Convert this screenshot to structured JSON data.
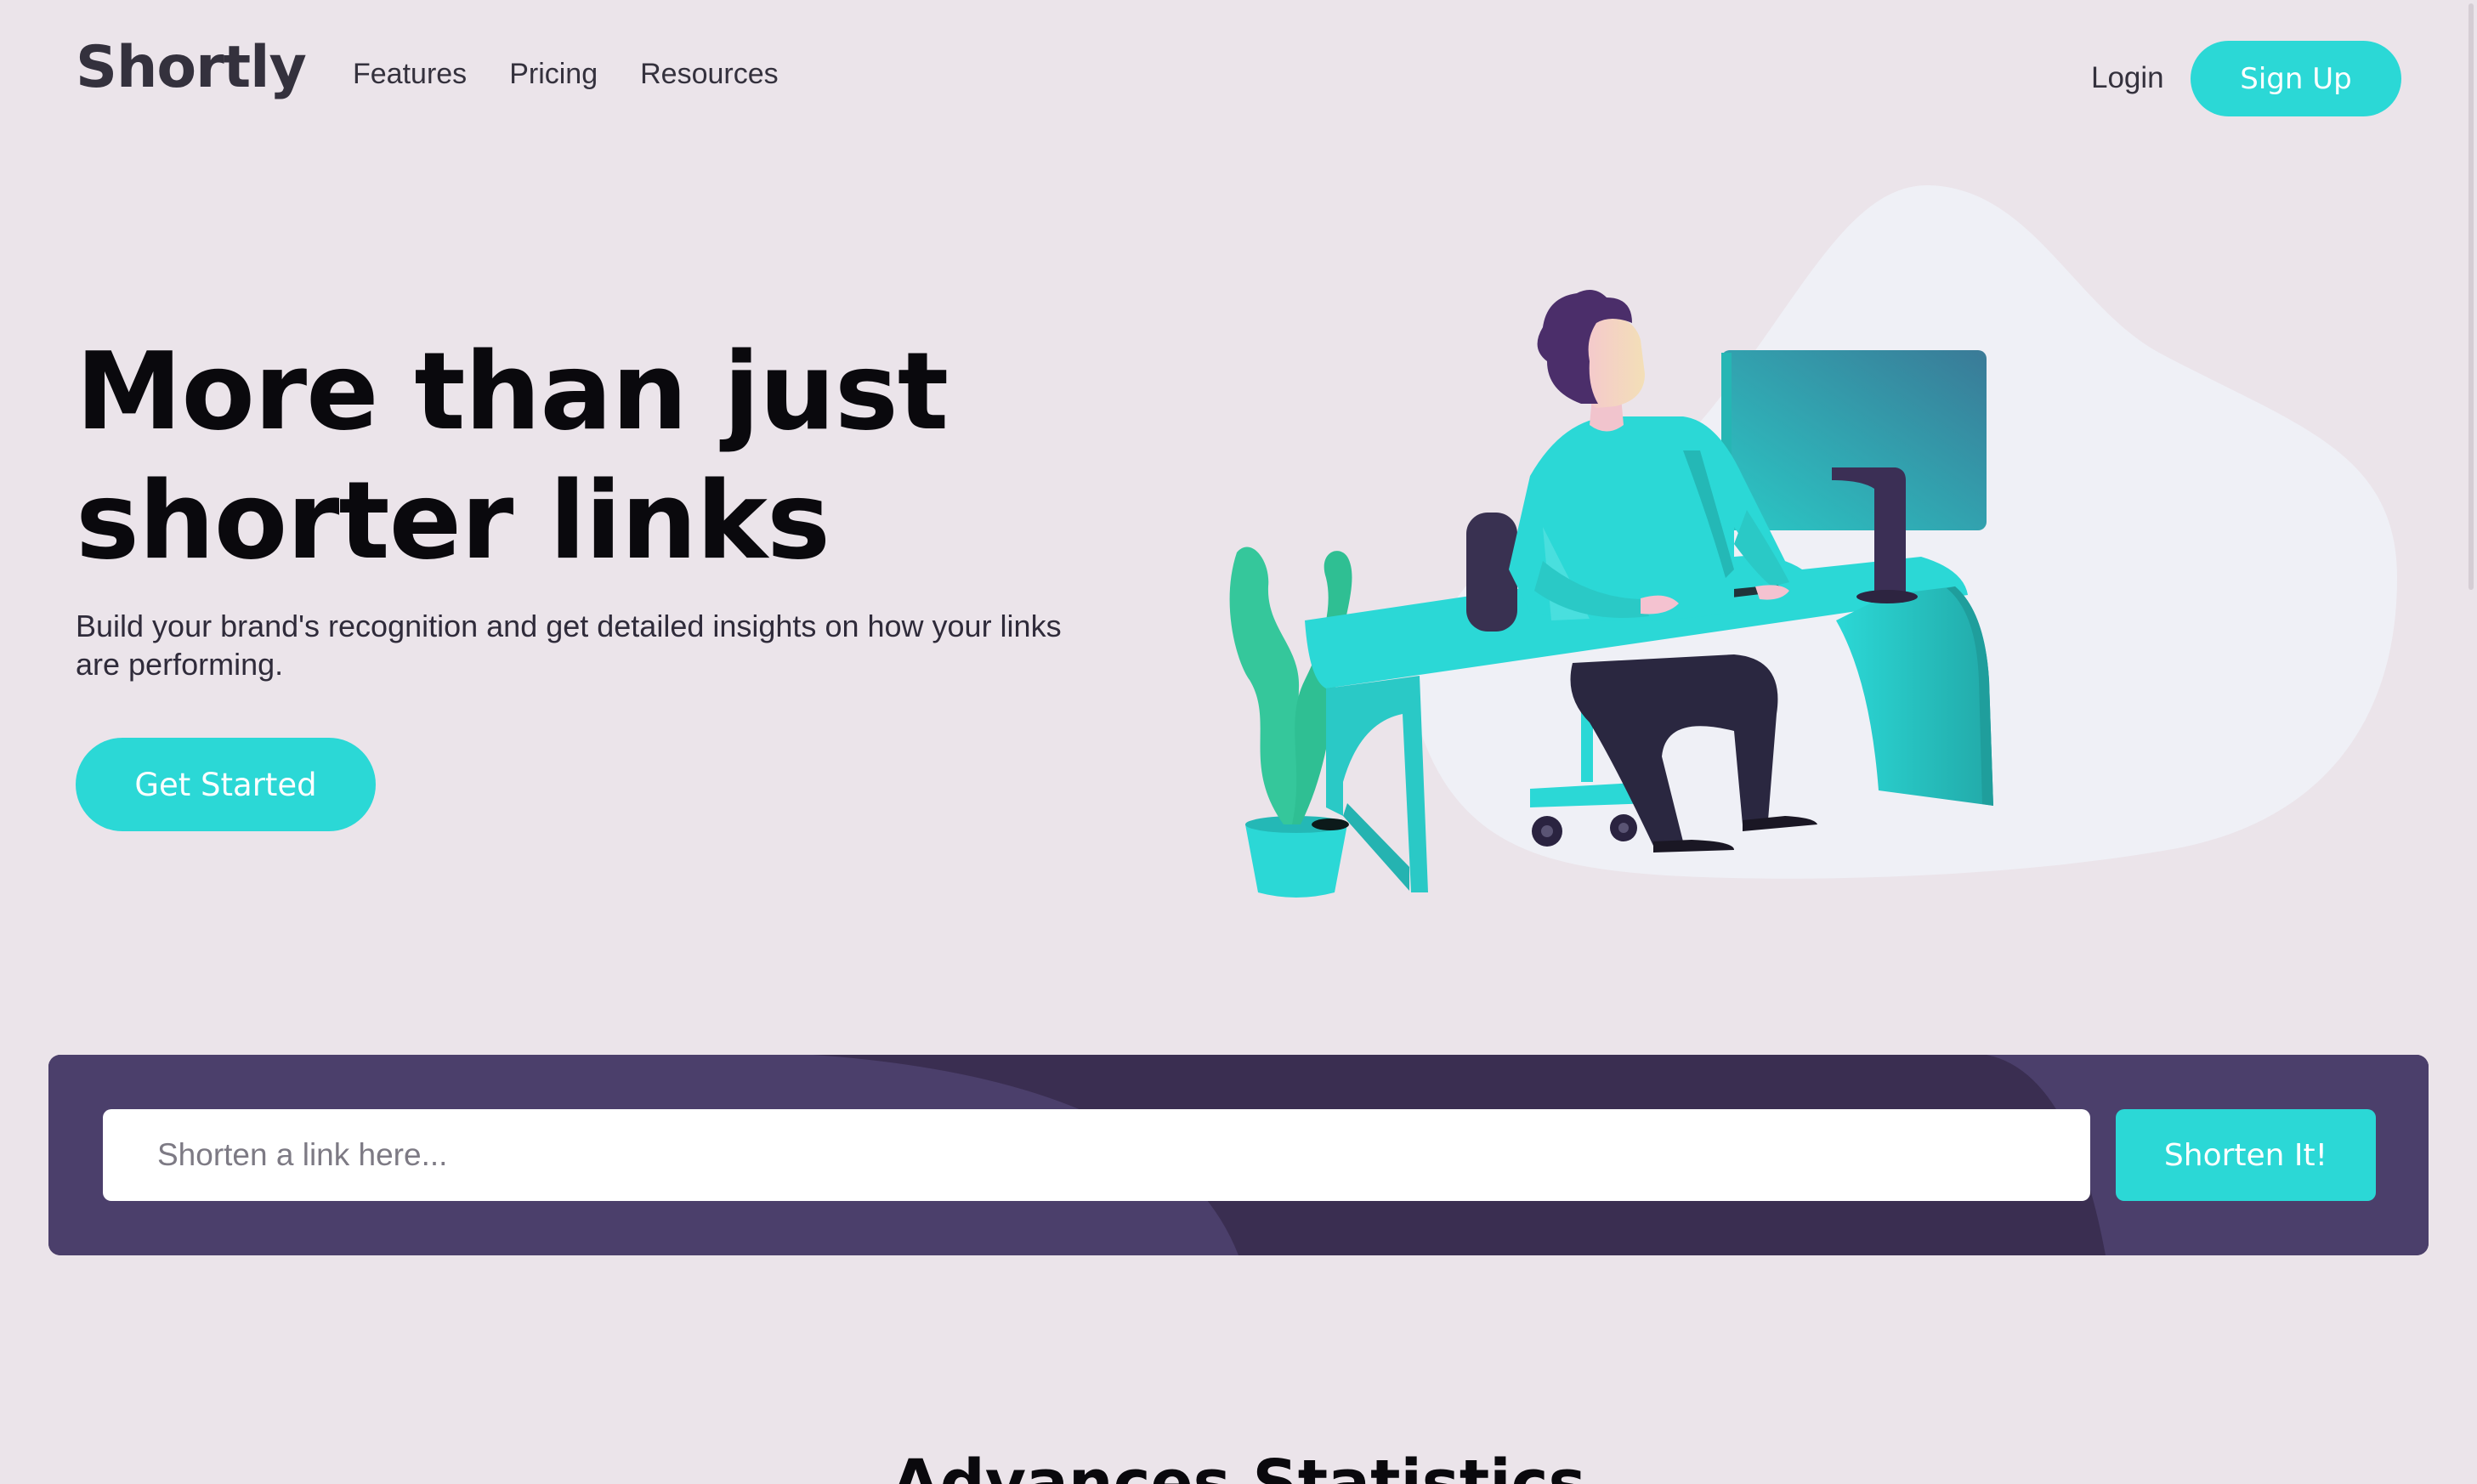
{
  "header": {
    "logo": "Shortly",
    "nav": [
      {
        "label": "Features"
      },
      {
        "label": "Pricing"
      },
      {
        "label": "Resources"
      }
    ],
    "login_label": "Login",
    "signup_label": "Sign Up"
  },
  "hero": {
    "title": "More than just shorter links",
    "subtitle": "Build your brand's recognition and get detailed insights on how your links are performing.",
    "cta_label": "Get Started",
    "illustration_icon": "person-working-at-desk-illustration"
  },
  "shorten": {
    "placeholder": "Shorten a link here...",
    "value": "",
    "button_label": "Shorten It!"
  },
  "stats": {
    "title": "Advances Statistics"
  },
  "colors": {
    "background": "#ebe4ea",
    "accent": "#2bd8d6",
    "panel": "#3a2e51",
    "text_dark": "#0a090d"
  }
}
